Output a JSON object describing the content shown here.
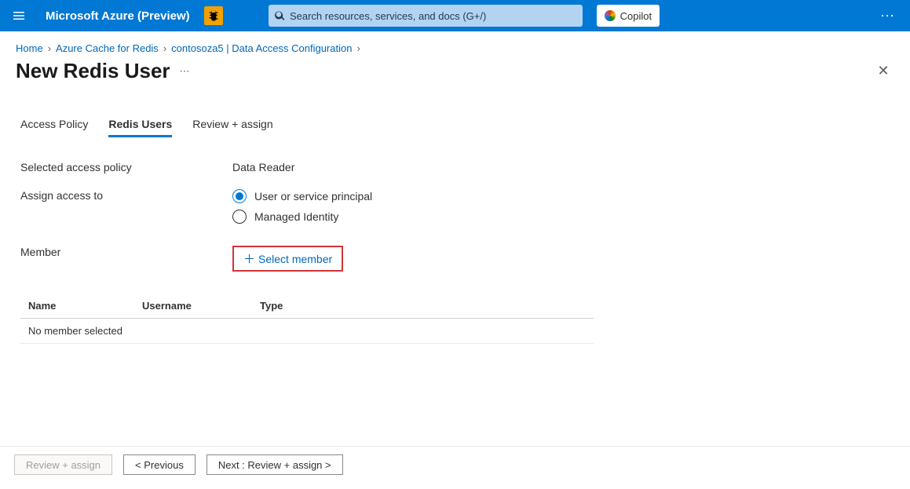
{
  "header": {
    "brand": "Microsoft Azure (Preview)",
    "search_placeholder": "Search resources, services, and docs (G+/)",
    "copilot_label": "Copilot"
  },
  "breadcrumbs": {
    "items": [
      "Home",
      "Azure Cache for Redis",
      "contosoza5 | Data Access Configuration"
    ]
  },
  "page": {
    "title": "New Redis User"
  },
  "tabs": {
    "items": [
      {
        "label": "Access Policy",
        "active": false
      },
      {
        "label": "Redis Users",
        "active": true
      },
      {
        "label": "Review + assign",
        "active": false
      }
    ]
  },
  "form": {
    "selected_policy_label": "Selected access policy",
    "selected_policy_value": "Data Reader",
    "assign_label": "Assign access to",
    "option_user": "User or service principal",
    "option_managed": "Managed Identity",
    "member_label": "Member",
    "select_member_label": "Select member"
  },
  "member_table": {
    "columns": {
      "name": "Name",
      "username": "Username",
      "type": "Type"
    },
    "empty_message": "No member selected"
  },
  "footer": {
    "review": "Review + assign",
    "previous": "< Previous",
    "next": "Next : Review + assign >"
  }
}
